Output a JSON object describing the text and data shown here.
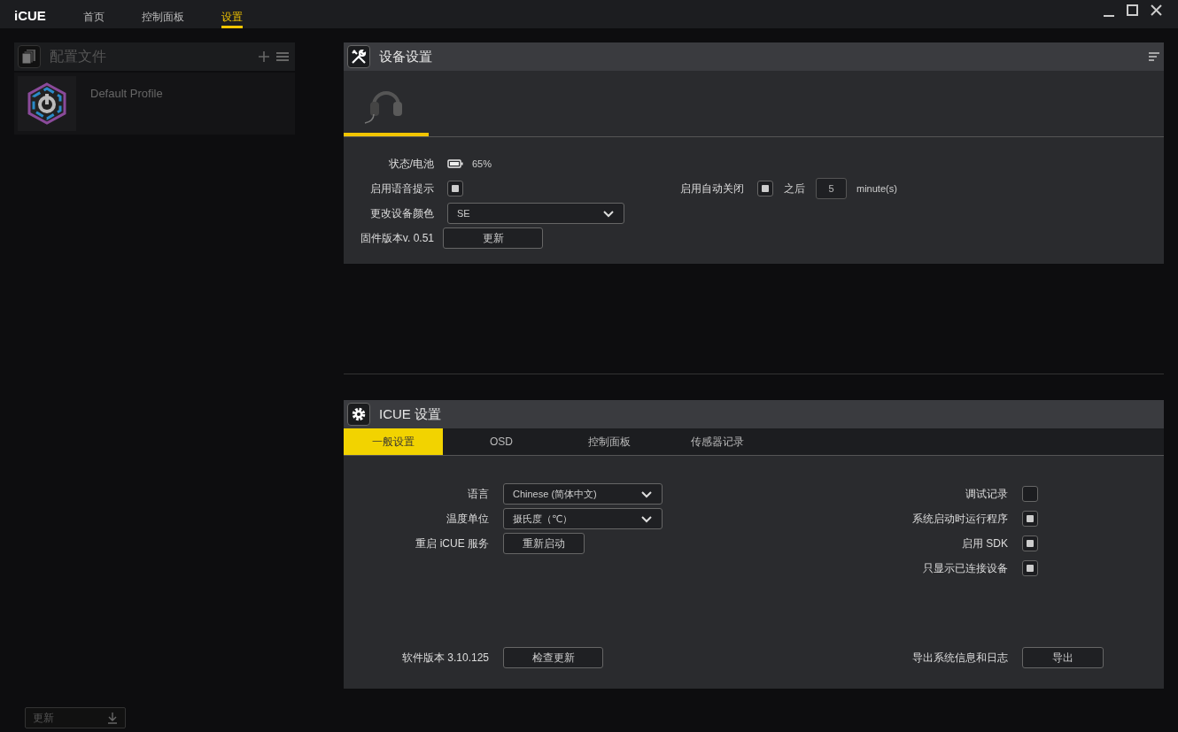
{
  "app": {
    "logo": "iCUE"
  },
  "nav": [
    {
      "label": "首页",
      "selected": false
    },
    {
      "label": "控制面板",
      "selected": false
    },
    {
      "label": "设置",
      "selected": true
    }
  ],
  "profiles": {
    "title": "配置文件",
    "items": [
      {
        "name": "Default Profile"
      }
    ]
  },
  "device_settings": {
    "title": "设备设置",
    "devices": [
      {
        "kind": "headset",
        "selected": true
      }
    ],
    "status": {
      "label": "状态/电池",
      "reading": "65%"
    },
    "voice_prompts": {
      "label": "启用语音提示",
      "checked": true
    },
    "auto_off": {
      "label": "启用自动关闭",
      "checked": true,
      "after": "之后",
      "value": "5",
      "unit": "minute(s)"
    },
    "color": {
      "label": "更改设备颜色",
      "value": "SE"
    },
    "firmware": {
      "label": "固件版本v. 0.51",
      "button": "更新"
    }
  },
  "icue_settings": {
    "title": "ICUE 设置",
    "tabs": [
      {
        "label": "一般设置",
        "selected": true
      },
      {
        "label": "OSD",
        "selected": false
      },
      {
        "label": "控制面板",
        "selected": false
      },
      {
        "label": "传感器记录",
        "selected": false
      }
    ],
    "rows": [
      {
        "kind": "select",
        "label": "语言",
        "value": "Chinese (简体中文)"
      },
      {
        "kind": "select",
        "label": "温度单位",
        "value": "摄氏度（℃）"
      },
      {
        "kind": "button",
        "label": "重启 iCUE 服务",
        "button": "重新启动"
      }
    ],
    "options": [
      {
        "label": "调试记录",
        "checked": false
      },
      {
        "label": "系统启动时运行程序",
        "checked": true
      },
      {
        "label": "启用 SDK",
        "checked": true
      },
      {
        "label": "只显示已连接设备",
        "checked": true
      }
    ],
    "version": {
      "label": "软件版本 3.10.125",
      "button": "检查更新"
    },
    "export": {
      "label": "导出系统信息和日志",
      "button": "导出"
    }
  },
  "footer": {
    "update_button": "更新"
  }
}
